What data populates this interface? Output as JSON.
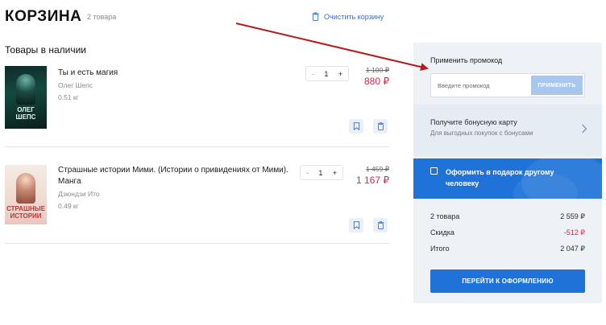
{
  "header": {
    "title": "КОРЗИНА",
    "count": "2 товара",
    "clear_label": "Очистить корзину"
  },
  "section_title": "Товары в наличии",
  "items": [
    {
      "cover_text": "ОЛЕГ ШЕПС",
      "title": "Ты и есть магия",
      "author": "Олег Шепс",
      "weight": "0.51 кг",
      "qty": "1",
      "minus": "-",
      "plus": "+",
      "old_price": "1 100 ₽",
      "price": "880 ₽"
    },
    {
      "cover_text": "СТРАШНЫЕ ИСТОРИИ",
      "title": "Страшные истории Мими. (Истории о привидениях от Мими). Манга",
      "author": "Дзюндзи Ито",
      "weight": "0.49 кг",
      "qty": "1",
      "minus": "-",
      "plus": "+",
      "old_price": "1 459 ₽",
      "price": "1 167 ₽"
    }
  ],
  "sidebar": {
    "promo_label": "Применить промокод",
    "promo_placeholder": "Введите промокод",
    "promo_apply": "ПРИМЕНИТЬ",
    "bonus_title": "Получите бонусную карту",
    "bonus_sub": "Для выгодных покупок с бонусами",
    "gift_label": "Оформить в подарок другому человеку",
    "summary": {
      "items_label": "2 товара",
      "items_value": "2 559 ₽",
      "discount_label": "Скидка",
      "discount_value": "-512 ₽",
      "total_label": "Итого",
      "total_value": "2 047 ₽"
    },
    "checkout": "ПЕРЕЙТИ К ОФОРМЛЕНИЮ"
  },
  "colors": {
    "accent": "#1f73d8",
    "price": "#d12a4a",
    "arrow": "#b51b1b"
  }
}
